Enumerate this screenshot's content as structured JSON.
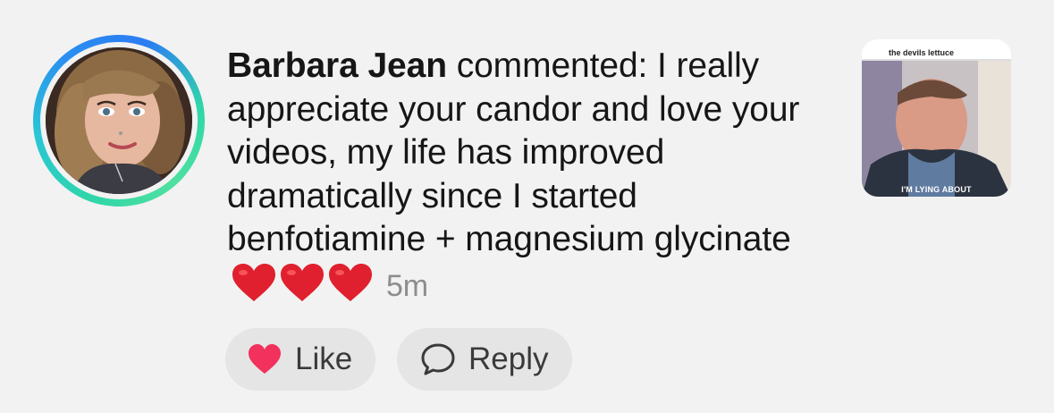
{
  "comment": {
    "author": "Barbara Jean",
    "text": " commented: I really appreciate your candor and love your videos, my life has improved dramatically since I started benfotiamine + magnesium glycinate ",
    "emoji_count": 3,
    "emoji": "red-heart",
    "timestamp": "5m"
  },
  "actions": {
    "like_label": "Like",
    "reply_label": "Reply",
    "like_icon": "heart-icon",
    "reply_icon": "speech-bubble-icon"
  },
  "video": {
    "overlay_text": "the devils lettuce",
    "caption": "I'M LYING ABOUT"
  },
  "colors": {
    "like_heart": "#f2315c",
    "emoji_heart": "#e0202e",
    "ring_start": "#2fd6a8",
    "ring_end": "#2a8ff0",
    "timestamp": "#8d8d8d"
  }
}
